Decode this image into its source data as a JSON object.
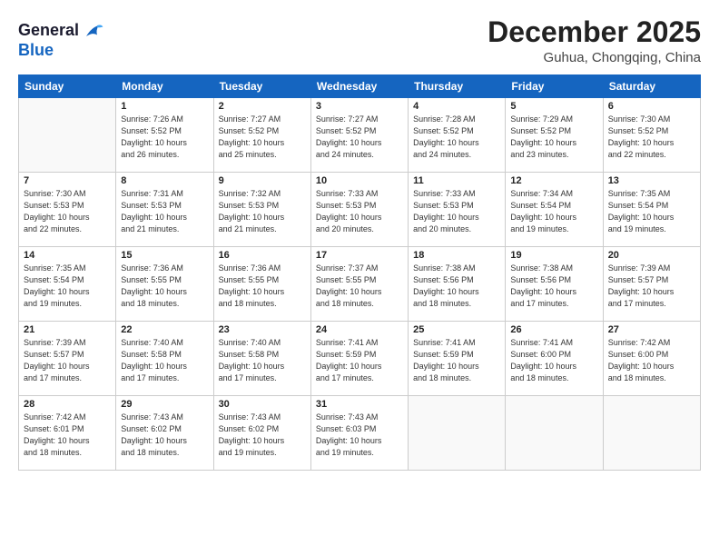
{
  "header": {
    "logo_line1": "General",
    "logo_line2": "Blue",
    "title": "December 2025",
    "location": "Guhua, Chongqing, China"
  },
  "weekdays": [
    "Sunday",
    "Monday",
    "Tuesday",
    "Wednesday",
    "Thursday",
    "Friday",
    "Saturday"
  ],
  "weeks": [
    [
      {
        "day": "",
        "info": ""
      },
      {
        "day": "1",
        "info": "Sunrise: 7:26 AM\nSunset: 5:52 PM\nDaylight: 10 hours\nand 26 minutes."
      },
      {
        "day": "2",
        "info": "Sunrise: 7:27 AM\nSunset: 5:52 PM\nDaylight: 10 hours\nand 25 minutes."
      },
      {
        "day": "3",
        "info": "Sunrise: 7:27 AM\nSunset: 5:52 PM\nDaylight: 10 hours\nand 24 minutes."
      },
      {
        "day": "4",
        "info": "Sunrise: 7:28 AM\nSunset: 5:52 PM\nDaylight: 10 hours\nand 24 minutes."
      },
      {
        "day": "5",
        "info": "Sunrise: 7:29 AM\nSunset: 5:52 PM\nDaylight: 10 hours\nand 23 minutes."
      },
      {
        "day": "6",
        "info": "Sunrise: 7:30 AM\nSunset: 5:52 PM\nDaylight: 10 hours\nand 22 minutes."
      }
    ],
    [
      {
        "day": "7",
        "info": "Sunrise: 7:30 AM\nSunset: 5:53 PM\nDaylight: 10 hours\nand 22 minutes."
      },
      {
        "day": "8",
        "info": "Sunrise: 7:31 AM\nSunset: 5:53 PM\nDaylight: 10 hours\nand 21 minutes."
      },
      {
        "day": "9",
        "info": "Sunrise: 7:32 AM\nSunset: 5:53 PM\nDaylight: 10 hours\nand 21 minutes."
      },
      {
        "day": "10",
        "info": "Sunrise: 7:33 AM\nSunset: 5:53 PM\nDaylight: 10 hours\nand 20 minutes."
      },
      {
        "day": "11",
        "info": "Sunrise: 7:33 AM\nSunset: 5:53 PM\nDaylight: 10 hours\nand 20 minutes."
      },
      {
        "day": "12",
        "info": "Sunrise: 7:34 AM\nSunset: 5:54 PM\nDaylight: 10 hours\nand 19 minutes."
      },
      {
        "day": "13",
        "info": "Sunrise: 7:35 AM\nSunset: 5:54 PM\nDaylight: 10 hours\nand 19 minutes."
      }
    ],
    [
      {
        "day": "14",
        "info": "Sunrise: 7:35 AM\nSunset: 5:54 PM\nDaylight: 10 hours\nand 19 minutes."
      },
      {
        "day": "15",
        "info": "Sunrise: 7:36 AM\nSunset: 5:55 PM\nDaylight: 10 hours\nand 18 minutes."
      },
      {
        "day": "16",
        "info": "Sunrise: 7:36 AM\nSunset: 5:55 PM\nDaylight: 10 hours\nand 18 minutes."
      },
      {
        "day": "17",
        "info": "Sunrise: 7:37 AM\nSunset: 5:55 PM\nDaylight: 10 hours\nand 18 minutes."
      },
      {
        "day": "18",
        "info": "Sunrise: 7:38 AM\nSunset: 5:56 PM\nDaylight: 10 hours\nand 18 minutes."
      },
      {
        "day": "19",
        "info": "Sunrise: 7:38 AM\nSunset: 5:56 PM\nDaylight: 10 hours\nand 17 minutes."
      },
      {
        "day": "20",
        "info": "Sunrise: 7:39 AM\nSunset: 5:57 PM\nDaylight: 10 hours\nand 17 minutes."
      }
    ],
    [
      {
        "day": "21",
        "info": "Sunrise: 7:39 AM\nSunset: 5:57 PM\nDaylight: 10 hours\nand 17 minutes."
      },
      {
        "day": "22",
        "info": "Sunrise: 7:40 AM\nSunset: 5:58 PM\nDaylight: 10 hours\nand 17 minutes."
      },
      {
        "day": "23",
        "info": "Sunrise: 7:40 AM\nSunset: 5:58 PM\nDaylight: 10 hours\nand 17 minutes."
      },
      {
        "day": "24",
        "info": "Sunrise: 7:41 AM\nSunset: 5:59 PM\nDaylight: 10 hours\nand 17 minutes."
      },
      {
        "day": "25",
        "info": "Sunrise: 7:41 AM\nSunset: 5:59 PM\nDaylight: 10 hours\nand 18 minutes."
      },
      {
        "day": "26",
        "info": "Sunrise: 7:41 AM\nSunset: 6:00 PM\nDaylight: 10 hours\nand 18 minutes."
      },
      {
        "day": "27",
        "info": "Sunrise: 7:42 AM\nSunset: 6:00 PM\nDaylight: 10 hours\nand 18 minutes."
      }
    ],
    [
      {
        "day": "28",
        "info": "Sunrise: 7:42 AM\nSunset: 6:01 PM\nDaylight: 10 hours\nand 18 minutes."
      },
      {
        "day": "29",
        "info": "Sunrise: 7:43 AM\nSunset: 6:02 PM\nDaylight: 10 hours\nand 18 minutes."
      },
      {
        "day": "30",
        "info": "Sunrise: 7:43 AM\nSunset: 6:02 PM\nDaylight: 10 hours\nand 19 minutes."
      },
      {
        "day": "31",
        "info": "Sunrise: 7:43 AM\nSunset: 6:03 PM\nDaylight: 10 hours\nand 19 minutes."
      },
      {
        "day": "",
        "info": ""
      },
      {
        "day": "",
        "info": ""
      },
      {
        "day": "",
        "info": ""
      }
    ]
  ]
}
